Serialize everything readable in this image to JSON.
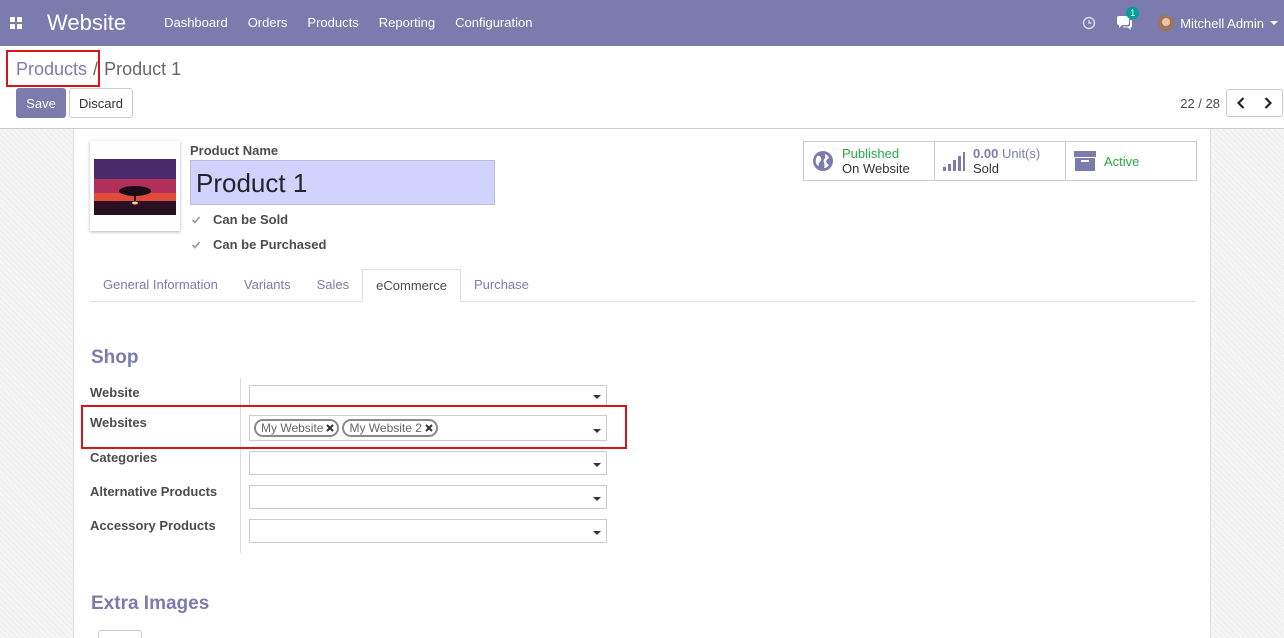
{
  "navbar": {
    "brand": "Website",
    "menu": [
      "Dashboard",
      "Orders",
      "Products",
      "Reporting",
      "Configuration"
    ],
    "chat_badge": "1",
    "user": "Mitchell Admin",
    "color": "#7c7bad"
  },
  "breadcrumb": {
    "parent": "Products",
    "separator": "/",
    "current": "Product 1"
  },
  "buttons": {
    "save": "Save",
    "discard": "Discard"
  },
  "pager": {
    "value": "22 / 28"
  },
  "product": {
    "name_label": "Product Name",
    "name": "Product 1",
    "can_be_sold": "Can be Sold",
    "can_be_purchased": "Can be Purchased"
  },
  "smart_buttons": {
    "published": "Published",
    "on_website": "On Website",
    "sold_value": "0.00",
    "sold_unit": "Unit(s)",
    "sold_label": "Sold",
    "active": "Active"
  },
  "tabs": [
    "General Information",
    "Variants",
    "Sales",
    "eCommerce",
    "Purchase"
  ],
  "active_tab": "eCommerce",
  "shop": {
    "title": "Shop",
    "website_label": "Website",
    "websites_label": "Websites",
    "website_tags": [
      "My Website",
      "My Website 2"
    ],
    "categories_label": "Categories",
    "alternative_label": "Alternative Products",
    "accessory_label": "Accessory Products"
  },
  "extra_images": {
    "title": "Extra Images"
  }
}
